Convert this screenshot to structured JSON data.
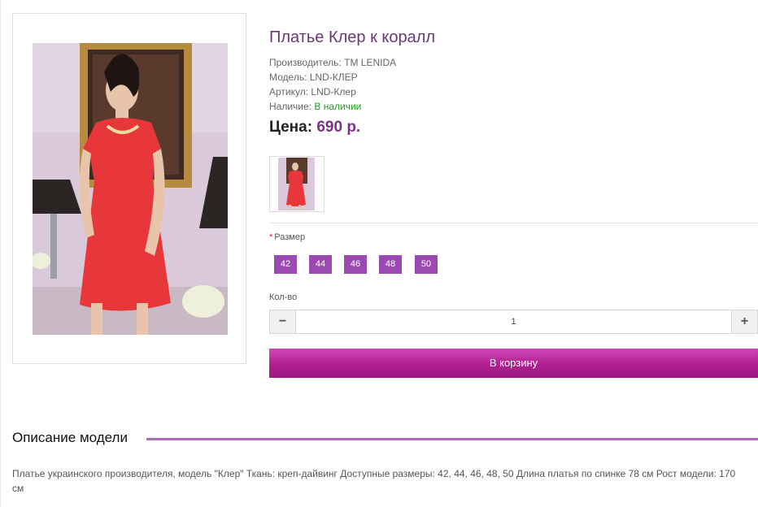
{
  "product": {
    "title": "Платье Клер к коралл",
    "manufacturer_label": "Производитель:",
    "manufacturer": "ТМ LENIDA",
    "model_label": "Модель:",
    "model": "LND-КЛЕР",
    "article_label": "Артикул:",
    "article": "LND-Клер",
    "availability_label": "Наличие:",
    "availability": "В наличии",
    "price_label": "Цена:",
    "price": "690 р."
  },
  "options": {
    "size_label": "Размер",
    "sizes": [
      "42",
      "44",
      "46",
      "48",
      "50"
    ],
    "qty_label": "Кол-во",
    "qty_value": "1",
    "minus_symbol": "−",
    "plus_symbol": "+"
  },
  "cart": {
    "button_label": "В корзину"
  },
  "description": {
    "title": "Описание модели",
    "text": "Платье украинского производителя, модель \"Клер\" Ткань: креп-дайвинг Доступные размеры: 42, 44, 46, 48, 50 Длина платья по спинке 78 см Рост модели: 170 см"
  },
  "colors": {
    "accent": "#9a4ab0",
    "title": "#6b3776",
    "in_stock": "#1d9b1d",
    "cart_button": "#b0208f"
  },
  "icons": {
    "minus": "minus-icon",
    "plus": "plus-icon"
  }
}
